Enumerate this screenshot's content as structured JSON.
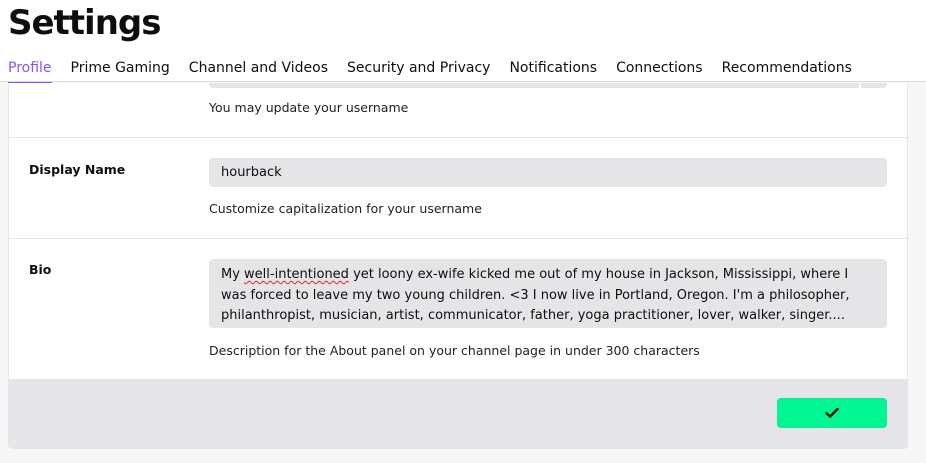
{
  "page": {
    "title": "Settings"
  },
  "tabs": [
    {
      "label": "Profile",
      "active": true
    },
    {
      "label": "Prime Gaming"
    },
    {
      "label": "Channel and Videos"
    },
    {
      "label": "Security and Privacy"
    },
    {
      "label": "Notifications"
    },
    {
      "label": "Connections"
    },
    {
      "label": "Recommendations"
    }
  ],
  "username": {
    "hint": "You may update your username"
  },
  "display_name": {
    "label": "Display Name",
    "value": "hourback",
    "hint": "Customize capitalization for your username"
  },
  "bio": {
    "label": "Bio",
    "value_prefix": "My ",
    "value_misspelled": "well-intentioned",
    "value_rest": " yet loony ex-wife kicked me out of my house in Jackson, Mississippi, where I was forced to leave my two young children. <3 I now live in Portland, Oregon.  I'm a philosopher, philanthropist, musician, artist, communicator, father, yoga practitioner, lover, walker, singer....",
    "hint": "Description for the About panel on your channel page in under 300 characters"
  },
  "footer": {
    "save_icon": "checkmark-icon"
  },
  "colors": {
    "accent": "#8b51f0",
    "save_button": "#00f593"
  }
}
